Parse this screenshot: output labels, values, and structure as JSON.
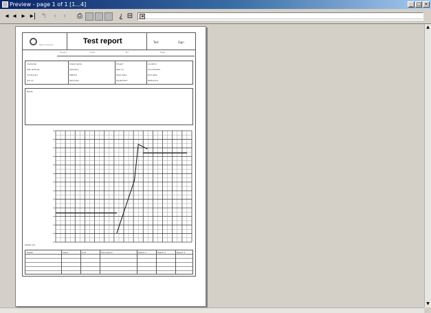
{
  "window": {
    "title": "Preview - page 1 of 1 [1...4]",
    "min_label": "_",
    "max_label": "□",
    "close_label": "×"
  },
  "toolbar": {
    "first_glyph": "◂",
    "prev_glyph": "◂",
    "next_glyph": "▸",
    "last_glyph": "▸|",
    "zoom_glyph": "◂"
  },
  "report": {
    "logo_caption": "Test company",
    "title": "Test report",
    "header_right_1": "Test",
    "header_right_2": "Sign",
    "header_small_1": "Project",
    "header_small_2": "Date",
    "header_small_3": "No.",
    "header_small_4": "Page",
    "info_rows": [
      [
        "Customer",
        "Client name",
        "Project",
        "Location"
      ],
      [
        "Site address",
        "Operator",
        "Test no.",
        "Coordinates"
      ],
      [
        "Contractor",
        "Method",
        "Start date",
        "End date"
      ],
      [
        "Job no.",
        "Test type",
        "Equipment",
        "Reference"
      ]
    ],
    "remarks_label": "Notes",
    "chart_footer": "Depth (m)",
    "table2_headers": [
      "Depth",
      "Value",
      "Unit",
      "Description",
      "Result 1",
      "Result 2",
      "Result 3"
    ]
  },
  "chart_data": {
    "type": "line",
    "title": "",
    "xlabel": "",
    "ylabel": "",
    "x_major_ticks": 14,
    "y_major_ticks": 13,
    "grid": true,
    "series": [
      {
        "values_xy": [
          [
            6.3,
            11.9
          ],
          [
            8.1,
            5.8
          ],
          [
            8.5,
            1.6
          ],
          [
            9.4,
            2.1
          ],
          [
            9.4,
            2.1
          ]
        ]
      }
    ],
    "reference_lines": [
      {
        "axis": "y",
        "value": 9.6,
        "x_from": 0,
        "x_to": 6.3
      },
      {
        "axis": "y",
        "value": 2.6,
        "x_from": 9.0,
        "x_to": 13.5
      }
    ],
    "y_tick_labels": [
      "",
      "",
      "",
      "",
      "",
      "",
      "",
      "",
      "",
      "",
      "",
      "",
      ""
    ]
  }
}
